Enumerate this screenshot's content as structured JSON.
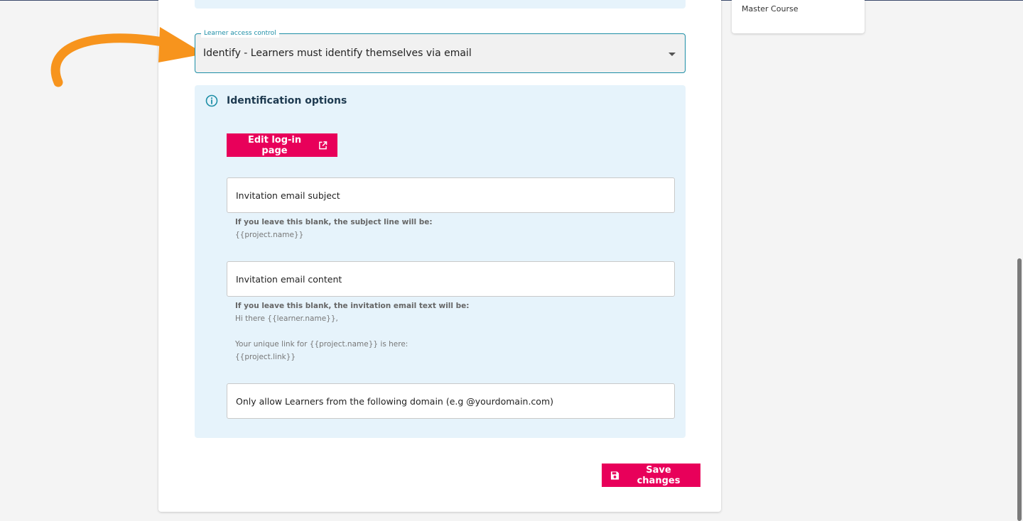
{
  "side_card": {
    "title": "Master Course"
  },
  "access_control": {
    "label": "Learner access control",
    "value": "Identify - Learners must identify themselves via email"
  },
  "identification": {
    "title": "Identification options",
    "edit_button": "Edit log-in page",
    "subject_field": {
      "placeholder": "Invitation email subject",
      "hint_label": "If you leave this blank, the subject line will be:",
      "hint_value": "{{project.name}}"
    },
    "content_field": {
      "placeholder": "Invitation email content",
      "hint_label": "If you leave this blank, the invitation email text will be:",
      "hint_line1": "Hi there {{learner.name}},",
      "hint_line2": "Your unique link for {{project.name}} is here:",
      "hint_line3": "{{project.link}}"
    },
    "domain_field": {
      "placeholder": "Only allow Learners from the following domain (e.g @yourdomain.com)"
    }
  },
  "save_button": "Save changes",
  "colors": {
    "accent": "#e8005a",
    "teal": "#1d8ea6",
    "panel": "#e6f3fb",
    "arrow": "#f7941d"
  },
  "icons": {
    "info": "info-icon",
    "external": "external-link-icon",
    "save": "floppy-disk-icon",
    "caret": "caret-down-icon"
  }
}
